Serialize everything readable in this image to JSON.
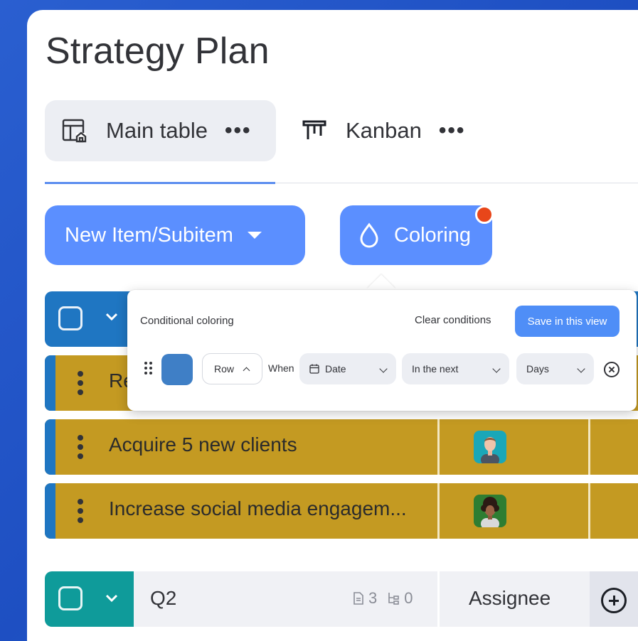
{
  "board": {
    "title": "Strategy Plan"
  },
  "tabs": [
    {
      "label": "Main table",
      "icon": "table-home-icon",
      "more": "•••"
    },
    {
      "label": "Kanban",
      "icon": "kanban-icon",
      "more": "•••"
    }
  ],
  "toolbar": {
    "new_item_label": "New Item/Subitem",
    "coloring_label": "Coloring"
  },
  "coloring_popover": {
    "title": "Conditional coloring",
    "clear_label": "Clear conditions",
    "save_label": "Save in this view",
    "rule": {
      "color": "#3f7fc6",
      "target": "Row",
      "when_label": "When",
      "column": "Date",
      "condition": "In the next",
      "unit": "Days"
    }
  },
  "rows": [
    {
      "name": "Re",
      "avatar": "avatar-1"
    },
    {
      "name": "Acquire 5 new clients",
      "avatar": "avatar-man"
    },
    {
      "name": "Increase social media engagem...",
      "avatar": "avatar-woman"
    }
  ],
  "group_q2": {
    "name": "Q2",
    "items_count": "3",
    "subitems_count": "0",
    "assignee_header": "Assignee"
  },
  "colors": {
    "accent": "#5b8fff",
    "row_fill": "#c49a22",
    "group_blue": "#1f76c2",
    "group_teal": "#0f9b9a",
    "notification": "#e8461a"
  }
}
